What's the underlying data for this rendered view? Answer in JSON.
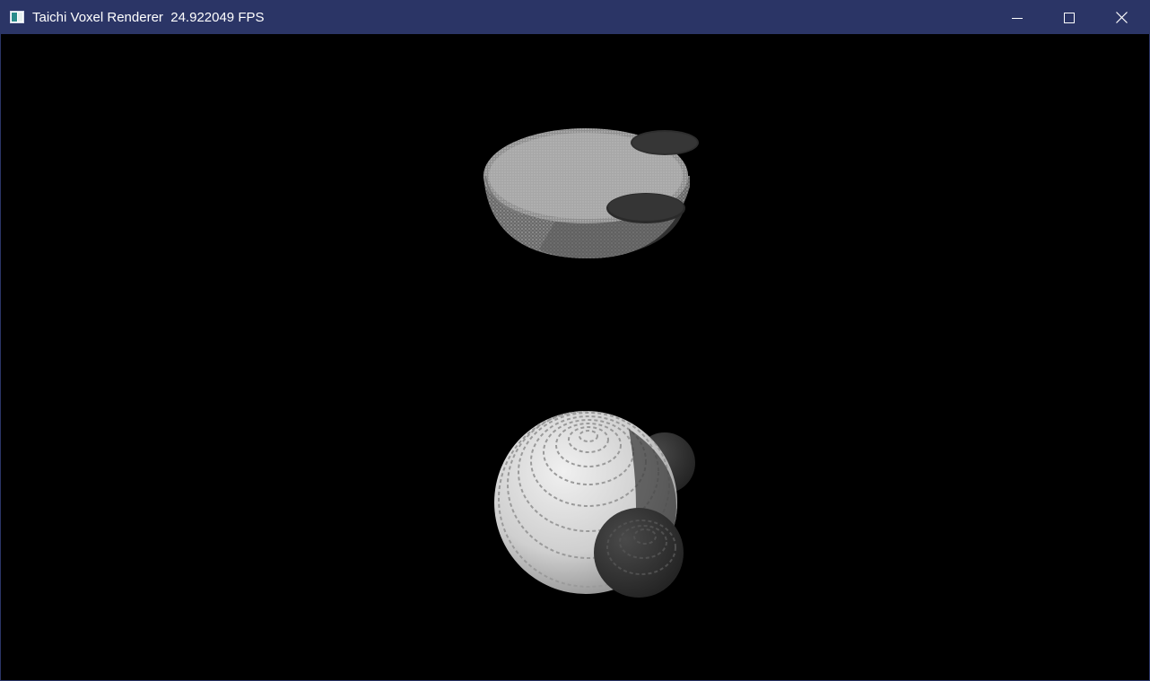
{
  "window": {
    "title": "Taichi Voxel Renderer  24.922049 FPS",
    "icon": "app-window-icon",
    "controls": {
      "minimize": "minimize-icon",
      "maximize": "maximize-icon",
      "close": "close-icon"
    },
    "colors": {
      "titlebar": "#2b3566",
      "title_text": "#ffffff",
      "background": "#000000"
    }
  },
  "scene": {
    "objects": [
      "voxel-bowl-with-disc-ears",
      "voxel-sphere-with-ears"
    ]
  }
}
